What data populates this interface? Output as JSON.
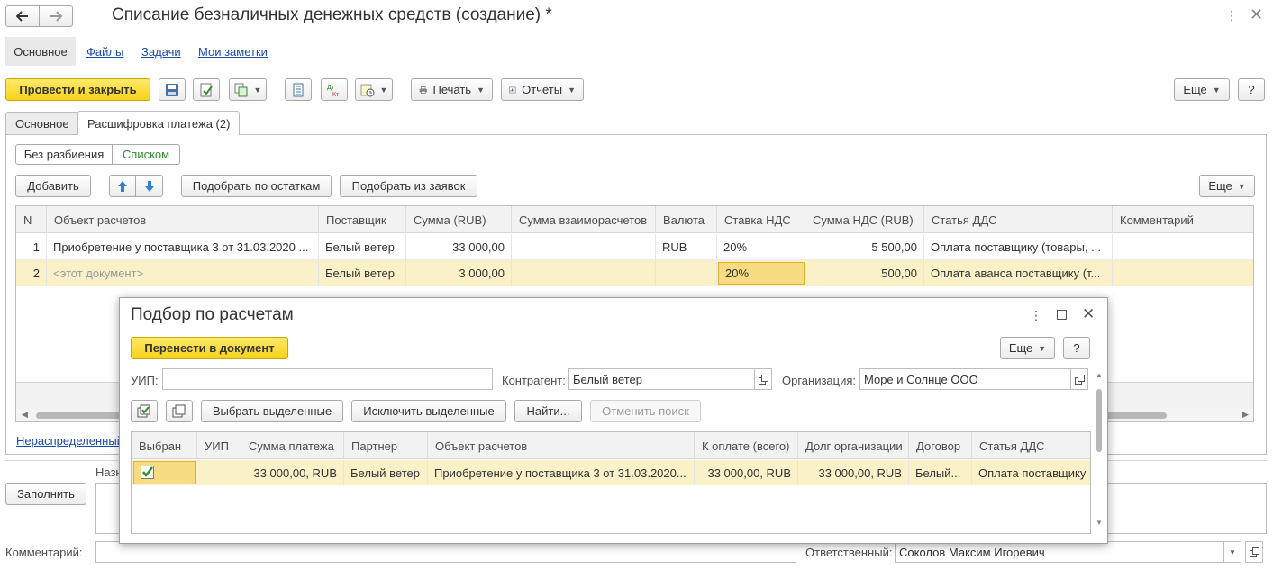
{
  "window": {
    "title": "Списание безналичных денежных средств (создание) *"
  },
  "nav": {
    "items": [
      "Основное",
      "Файлы",
      "Задачи",
      "Мои заметки"
    ]
  },
  "toolbar": {
    "post_close": "Провести и закрыть",
    "print": "Печать",
    "reports": "Отчеты",
    "more": "Еще",
    "help": "?"
  },
  "tabs": [
    "Основное",
    "Расшифровка платежа (2)"
  ],
  "split": {
    "no_split": "Без разбиения",
    "list": "Списком"
  },
  "actions": {
    "add": "Добавить",
    "pick_balance": "Подобрать по остаткам",
    "pick_requests": "Подобрать из заявок",
    "more": "Еще"
  },
  "table": {
    "columns": [
      "N",
      "Объект расчетов",
      "Поставщик",
      "Сумма (RUB)",
      "Сумма взаиморасчетов",
      "Валюта",
      "Ставка НДС",
      "Сумма НДС (RUB)",
      "Статья ДДС",
      "Комментарий"
    ],
    "rows": [
      {
        "n": "1",
        "object": "Приобретение у поставщика 3 от 31.03.2020 ...",
        "supplier": "Белый ветер",
        "sum": "33 000,00",
        "mutual": "",
        "currency": "RUB",
        "vat_rate": "20%",
        "vat_sum": "5 500,00",
        "dds": "Оплата поставщику (товары, ...",
        "comment": ""
      },
      {
        "n": "2",
        "object": "<этот документ>",
        "supplier": "Белый ветер",
        "sum": "3 000,00",
        "mutual": "",
        "currency": "",
        "vat_rate": "20%",
        "vat_sum": "500,00",
        "dds": "Оплата аванса поставщику (т...",
        "comment": ""
      }
    ]
  },
  "bottom": {
    "unallocated_link": "Нераспределенный",
    "purpose_label": "Назн",
    "fill_button": "Заполнить",
    "comment_label": "Комментарий:",
    "responsible_label": "Ответственный:",
    "responsible_value": "Соколов Максим Игоревич"
  },
  "dialog": {
    "title": "Подбор по расчетам",
    "transfer": "Перенести в документ",
    "more": "Еще",
    "help": "?",
    "uip_label": "УИП:",
    "uip_value": "",
    "counterparty_label": "Контрагент:",
    "counterparty_value": "Белый ветер",
    "org_label": "Организация:",
    "org_value": "Море и Солнце ООО",
    "select_selected": "Выбрать выделенные",
    "exclude_selected": "Исключить выделенные",
    "find": "Найти...",
    "cancel_search": "Отменить поиск",
    "columns": [
      "Выбран",
      "УИП",
      "Сумма платежа",
      "Партнер",
      "Объект расчетов",
      "К оплате (всего)",
      "Долг организации",
      "Договор",
      "Статья ДДС"
    ],
    "rows": [
      {
        "selected": true,
        "uip": "",
        "payment": "33 000,00, RUB",
        "partner": "Белый ветер",
        "object": "Приобретение у поставщика 3 от 31.03.2020...",
        "to_pay": "33 000,00, RUB",
        "debt": "33 000,00, RUB",
        "contract": "Белый...",
        "dds": "Оплата поставщику"
      }
    ]
  },
  "colors": {
    "accent_yellow": "#f6d31a",
    "selected_row": "#fbf1c8",
    "link": "#1c4aa8",
    "checkbox_green": "#2e8b2e"
  }
}
